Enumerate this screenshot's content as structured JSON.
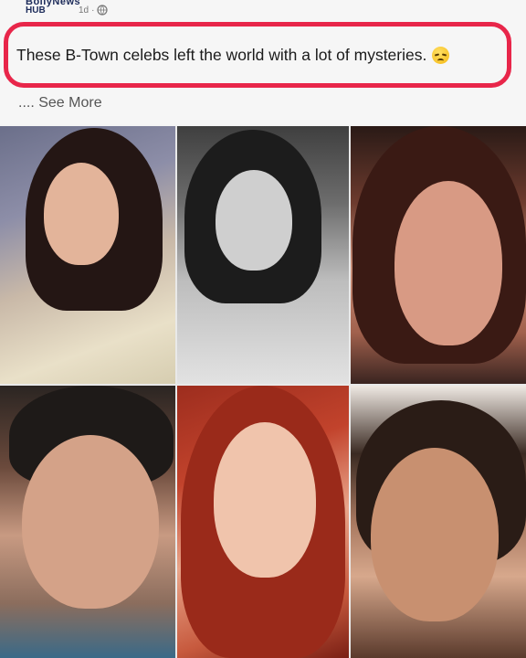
{
  "post": {
    "page_name": "BollyNews",
    "page_sub": "HUB",
    "time": "1d",
    "separator": "·",
    "caption": "These B-Town celebs left the world with a lot of mysteries.",
    "emoji": "disappointed-face-emoji",
    "see_more": ".... See More"
  },
  "colors": {
    "highlight": "#e8264a",
    "caption_text": "#1b1b1b",
    "see_more_text": "#555555",
    "page_name": "#1c2b5a"
  },
  "photos": [
    {
      "name": "celeb-photo-1"
    },
    {
      "name": "celeb-photo-2"
    },
    {
      "name": "celeb-photo-3"
    },
    {
      "name": "celeb-photo-4"
    },
    {
      "name": "celeb-photo-5"
    },
    {
      "name": "celeb-photo-6"
    }
  ]
}
